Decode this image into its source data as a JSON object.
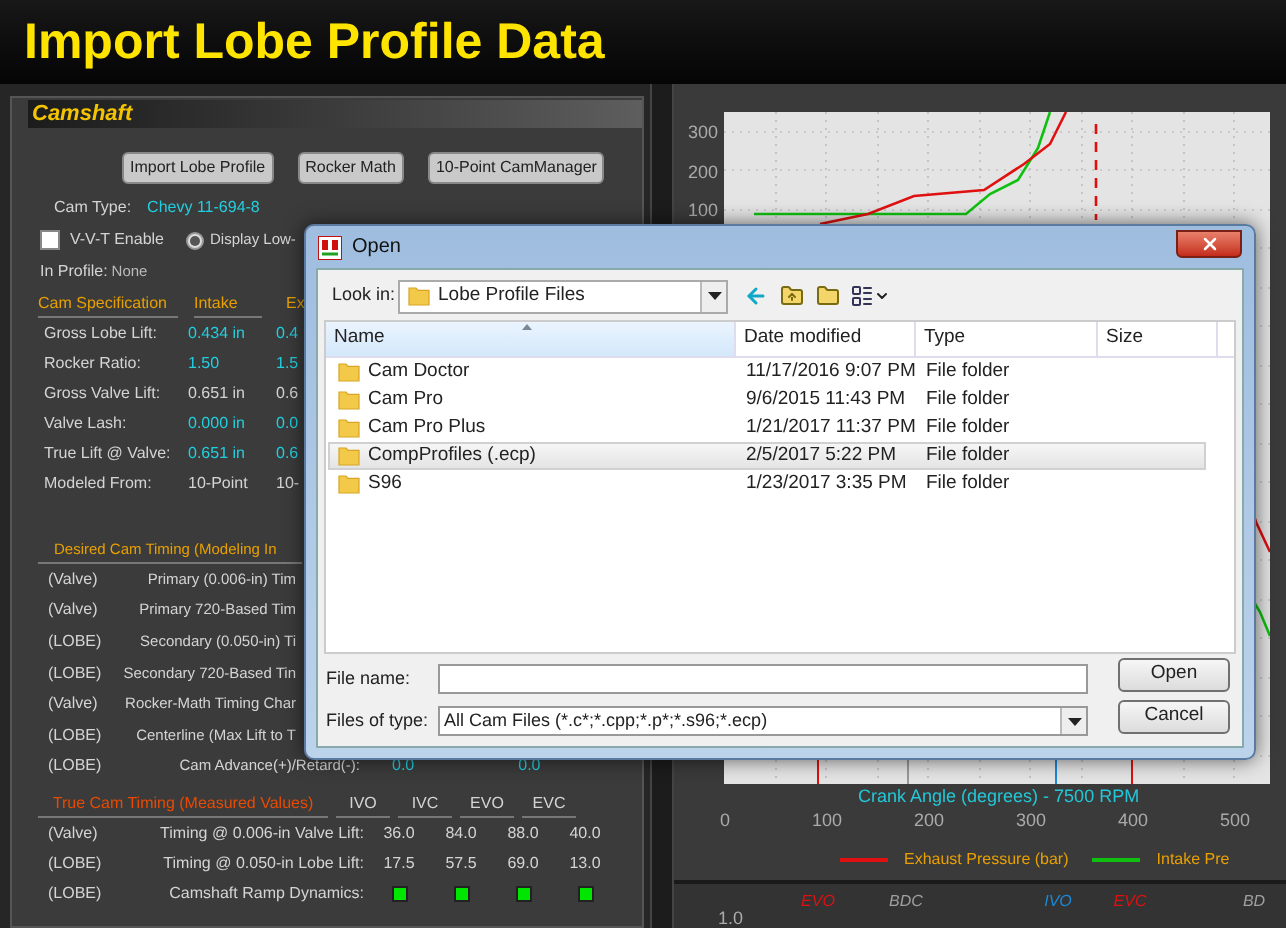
{
  "title": "Import Lobe Profile Data",
  "camshaft": {
    "heading": "Camshaft",
    "buttons": [
      "Import Lobe Profile",
      "Rocker Math",
      "10-Point CamManager"
    ],
    "cam_type": {
      "label": "Cam Type:",
      "value": "Chevy 11-694-8"
    },
    "vvt": {
      "label": "V-V-T Enable",
      "checked": false
    },
    "display_option": {
      "label": "Display Low-",
      "selected": true
    },
    "in_profile": {
      "label": "In Profile:",
      "value": "None"
    },
    "spec_columns": [
      "Cam Specification",
      "Intake",
      "Ex"
    ],
    "spec_rows": [
      {
        "label": "Gross Lobe Lift:",
        "intake": "0.434 in",
        "exhaust": "0.4",
        "editable": true
      },
      {
        "label": "Rocker Ratio:",
        "intake": "1.50",
        "exhaust": "1.5",
        "editable": true
      },
      {
        "label": "Gross Valve Lift:",
        "intake": "0.651 in",
        "exhaust": "0.6",
        "editable": false
      },
      {
        "label": "Valve Lash:",
        "intake": "0.000 in",
        "exhaust": "0.0",
        "editable": true
      },
      {
        "label": "True Lift @ Valve:",
        "intake": "0.651 in",
        "exhaust": "0.6",
        "editable": true
      },
      {
        "label": "Modeled From:",
        "intake": "10-Point",
        "exhaust": "10-",
        "editable": false
      }
    ],
    "desired_heading": "Desired Cam Timing (Modeling In",
    "desired_rows": [
      {
        "basis": "(Valve)",
        "label": "Primary (0.006-in) Tim"
      },
      {
        "basis": "(Valve)",
        "label": "Primary 720-Based Tim"
      },
      {
        "basis": "(LOBE)",
        "label": "Secondary (0.050-in) Ti"
      },
      {
        "basis": "(LOBE)",
        "label": "Secondary 720-Based Tin"
      },
      {
        "basis": "(Valve)",
        "label": "Rocker-Math Timing Char"
      },
      {
        "basis": "(LOBE)",
        "label": "Centerline (Max Lift to T"
      },
      {
        "basis": "(LOBE)",
        "label": "Cam Advance(+)/Retard(-):",
        "values": [
          "0.0",
          "0.0"
        ]
      }
    ],
    "true_heading": "True Cam Timing (Measured Values)",
    "true_columns": [
      "IVO",
      "IVC",
      "EVO",
      "EVC"
    ],
    "true_rows": [
      {
        "kind": "values",
        "basis": "(Valve)",
        "label": "Timing @ 0.006-in Valve Lift:",
        "values": [
          "36.0",
          "84.0",
          "88.0",
          "40.0"
        ]
      },
      {
        "kind": "values",
        "basis": "(LOBE)",
        "label": "Timing @ 0.050-in Lobe Lift:",
        "values": [
          "17.5",
          "57.5",
          "69.0",
          "13.0"
        ]
      },
      {
        "kind": "indicators",
        "basis": "(LOBE)",
        "label": "Camshaft Ramp Dynamics:",
        "indicators": [
          {
            "color": "#00e600"
          },
          {
            "color": "#00e600"
          },
          {
            "color": "#00e600"
          },
          {
            "color": "#00e600"
          }
        ]
      }
    ]
  },
  "chart": {
    "y_ticks": [
      "300",
      "200",
      "100"
    ],
    "x_ticks": [
      "0",
      "100",
      "200",
      "300",
      "400",
      "500"
    ],
    "x_title": "Crank Angle (degrees) - 7500 RPM",
    "legend": [
      {
        "label": "Exhaust Pressure (bar)",
        "color": "#e01010"
      },
      {
        "label": "Intake Pre",
        "color": "#10c010"
      }
    ]
  },
  "lower_chart": {
    "y_tick": "1.0",
    "markers": [
      {
        "label": "EVO",
        "color": "#e01010"
      },
      {
        "label": "BDC",
        "color": "#a0a0a0"
      },
      {
        "label": "IVO",
        "color": "#1a8ad8"
      },
      {
        "label": "EVC",
        "color": "#e01010"
      },
      {
        "label": "BD",
        "color": "#a0a0a0"
      }
    ]
  },
  "dialog": {
    "title": "Open",
    "look_in_label": "Look in:",
    "look_in": "Lobe Profile Files",
    "columns": [
      "Name",
      "Date modified",
      "Type",
      "Size"
    ],
    "files": [
      {
        "name": "Cam Doctor",
        "date": "11/17/2016 9:07 PM",
        "type": "File folder",
        "selected": false
      },
      {
        "name": "Cam Pro",
        "date": "9/6/2015 11:43 PM",
        "type": "File folder",
        "selected": false
      },
      {
        "name": "Cam Pro Plus",
        "date": "1/21/2017 11:37 PM",
        "type": "File folder",
        "selected": false
      },
      {
        "name": "CompProfiles (.ecp)",
        "date": "2/5/2017 5:22 PM",
        "type": "File folder",
        "selected": true
      },
      {
        "name": "S96",
        "date": "1/23/2017 3:35 PM",
        "type": "File folder",
        "selected": false
      }
    ],
    "file_name_label": "File name:",
    "files_of_type_label": "Files of type:",
    "files_of_type": "All Cam Files (*.c*;*.cpp;*.p*;*.s96;*.ecp)",
    "buttons": [
      "Open",
      "Cancel"
    ]
  }
}
